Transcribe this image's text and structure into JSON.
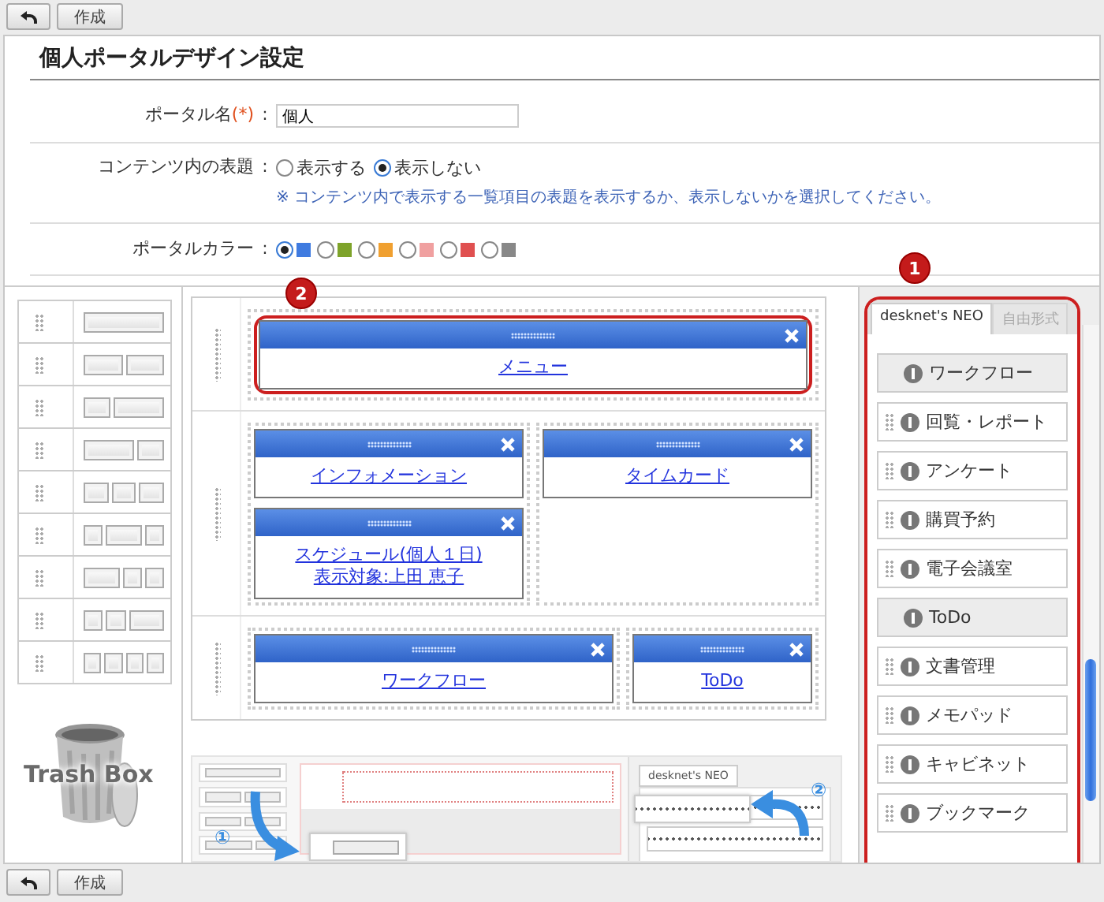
{
  "top_toolbar": {
    "buttons": [
      {
        "kind": "back"
      },
      {
        "kind": "text",
        "label": "作成"
      }
    ]
  },
  "title": "個人ポータルデザイン設定",
  "fields": [
    {
      "kind": "text",
      "label": "ポータル名",
      "required_mark": "(*)",
      "colon": ":",
      "value": "個人"
    },
    {
      "kind": "radio",
      "label": "コンテンツ内の表題",
      "colon": ":",
      "options": [
        {
          "label": "表示する",
          "selected": false
        },
        {
          "label": "表示しない",
          "selected": true
        }
      ],
      "note": "※ コンテンツ内で表示する一覧項目の表題を表示するか、表示しないかを選択してください。"
    },
    {
      "kind": "color",
      "label": "ポータルカラー",
      "colon": ":",
      "options": [
        {
          "color": "#3f7be0",
          "selected": true
        },
        {
          "color": "#7ea32a",
          "selected": false
        },
        {
          "color": "#f0a030",
          "selected": false
        },
        {
          "color": "#f0a0a0",
          "selected": false
        },
        {
          "color": "#e05050",
          "selected": false
        },
        {
          "color": "#888888",
          "selected": false
        }
      ]
    }
  ],
  "layout_templates": [
    {
      "blocks": [
        {
          "kind": "single"
        }
      ]
    },
    {
      "blocks": [
        {
          "kind": "single"
        },
        {
          "kind": "single"
        }
      ]
    },
    {
      "blocks": [
        {
          "kind": "single"
        },
        {
          "kind": "double"
        }
      ]
    },
    {
      "blocks": [
        {
          "kind": "double"
        },
        {
          "kind": "single"
        }
      ]
    },
    {
      "blocks": [
        {
          "kind": "single"
        },
        {
          "kind": "single"
        },
        {
          "kind": "single"
        }
      ]
    },
    {
      "blocks": [
        {
          "kind": "single"
        },
        {
          "kind": "double"
        },
        {
          "kind": "single"
        }
      ]
    },
    {
      "blocks": [
        {
          "kind": "double"
        },
        {
          "kind": "single"
        },
        {
          "kind": "single"
        }
      ]
    },
    {
      "blocks": [
        {
          "kind": "single"
        },
        {
          "kind": "single"
        },
        {
          "kind": "double"
        }
      ]
    },
    {
      "blocks": [
        {
          "kind": "single"
        },
        {
          "kind": "single"
        },
        {
          "kind": "single"
        },
        {
          "kind": "single"
        }
      ]
    }
  ],
  "trash": {
    "label": "Trash Box"
  },
  "layout_rows": [
    {
      "columns": [
        {
          "kind": "single",
          "portlets": [
            {
              "lines": [
                "メニュー"
              ],
              "callout": "2"
            }
          ]
        }
      ]
    },
    {
      "columns": [
        {
          "kind": "single",
          "portlets": [
            {
              "lines": [
                "インフォメーション"
              ]
            },
            {
              "lines": [
                "スケジュール(個人１日)",
                "表示対象:上田 恵子"
              ]
            }
          ]
        },
        {
          "kind": "single",
          "portlets": [
            {
              "lines": [
                "タイムカード"
              ]
            }
          ]
        }
      ]
    },
    {
      "columns": [
        {
          "kind": "double",
          "portlets": [
            {
              "lines": [
                "ワークフロー"
              ]
            }
          ]
        },
        {
          "kind": "single",
          "portlets": [
            {
              "lines": [
                "ToDo"
              ]
            }
          ]
        }
      ]
    }
  ],
  "tutorial": {
    "tab": "desknet's NEO",
    "steps": [
      "①",
      "②"
    ]
  },
  "palette": {
    "callout": "1",
    "tabs": [
      {
        "label": "desknet's NEO",
        "selected": true
      },
      {
        "label": "自由形式",
        "selected": false
      }
    ],
    "items": [
      {
        "label": "ワークフロー",
        "in_use": true
      },
      {
        "label": "回覧・レポート",
        "in_use": false
      },
      {
        "label": "アンケート",
        "in_use": false
      },
      {
        "label": "購買予約",
        "in_use": false
      },
      {
        "label": "電子会議室",
        "in_use": false
      },
      {
        "label": "ToDo",
        "in_use": true
      },
      {
        "label": "文書管理",
        "in_use": false
      },
      {
        "label": "メモパッド",
        "in_use": false
      },
      {
        "label": "キャビネット",
        "in_use": false
      },
      {
        "label": "ブックマーク",
        "in_use": false
      }
    ]
  },
  "bottom_toolbar": {
    "buttons": [
      {
        "kind": "back"
      },
      {
        "kind": "text",
        "label": "作成"
      }
    ]
  }
}
